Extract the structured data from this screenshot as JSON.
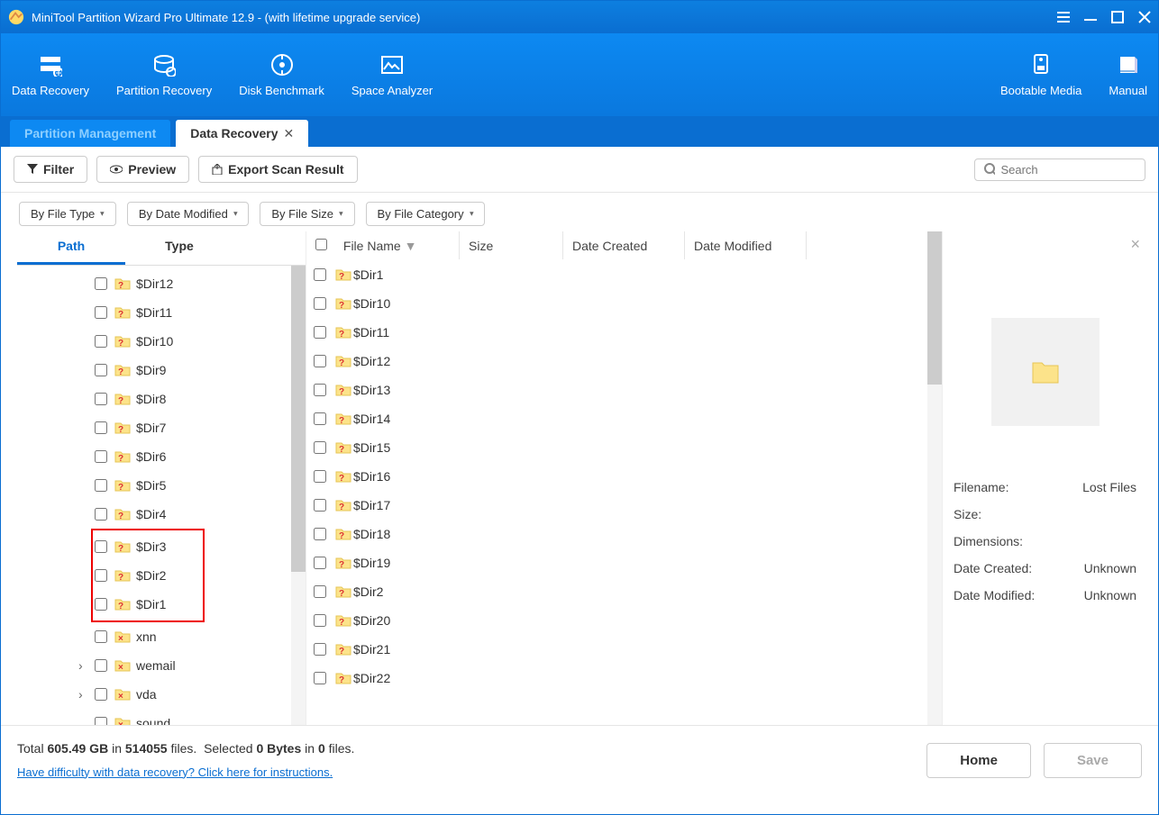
{
  "window": {
    "title": "MiniTool Partition Wizard Pro Ultimate 12.9 - (with lifetime upgrade service)"
  },
  "toolbar_left": [
    {
      "label": "Data Recovery"
    },
    {
      "label": "Partition Recovery"
    },
    {
      "label": "Disk Benchmark"
    },
    {
      "label": "Space Analyzer"
    }
  ],
  "toolbar_right": [
    {
      "label": "Bootable Media"
    },
    {
      "label": "Manual"
    }
  ],
  "tabs": {
    "inactive": "Partition Management",
    "active": "Data Recovery"
  },
  "actions": {
    "filter": "Filter",
    "preview": "Preview",
    "export": "Export Scan Result",
    "search_ph": "Search"
  },
  "filters": [
    "By File Type",
    "By Date Modified",
    "By File Size",
    "By File Category"
  ],
  "treetabs": {
    "path": "Path",
    "type": "Type"
  },
  "tree": [
    {
      "name": "$Dir12",
      "icon": "q"
    },
    {
      "name": "$Dir11",
      "icon": "q"
    },
    {
      "name": "$Dir10",
      "icon": "q"
    },
    {
      "name": "$Dir9",
      "icon": "q"
    },
    {
      "name": "$Dir8",
      "icon": "q"
    },
    {
      "name": "$Dir7",
      "icon": "q"
    },
    {
      "name": "$Dir6",
      "icon": "q"
    },
    {
      "name": "$Dir5",
      "icon": "q"
    },
    {
      "name": "$Dir4",
      "icon": "q"
    },
    {
      "name": "$Dir3",
      "icon": "q",
      "hl": true
    },
    {
      "name": "$Dir2",
      "icon": "q",
      "hl": true
    },
    {
      "name": "$Dir1",
      "icon": "q",
      "hl": true
    },
    {
      "name": "xnn",
      "icon": "x"
    },
    {
      "name": "wemail",
      "icon": "x",
      "expand": true
    },
    {
      "name": "vda",
      "icon": "x",
      "expand": true
    },
    {
      "name": "sound",
      "icon": "x"
    }
  ],
  "cols": {
    "name": "File Name",
    "size": "Size",
    "dc": "Date Created",
    "dm": "Date Modified"
  },
  "files": [
    "$Dir1",
    "$Dir10",
    "$Dir11",
    "$Dir12",
    "$Dir13",
    "$Dir14",
    "$Dir15",
    "$Dir16",
    "$Dir17",
    "$Dir18",
    "$Dir19",
    "$Dir2",
    "$Dir20",
    "$Dir21",
    "$Dir22"
  ],
  "meta": {
    "filename_k": "Filename:",
    "filename_v": "Lost Files",
    "size_k": "Size:",
    "size_v": "",
    "dim_k": "Dimensions:",
    "dim_v": "",
    "dc_k": "Date Created:",
    "dc_v": "Unknown",
    "dm_k": "Date Modified:",
    "dm_v": "Unknown"
  },
  "stats": {
    "total": "605.49 GB",
    "in": "514055",
    "filesword": "files.",
    "selword": "Selected",
    "selbytes": "0 Bytes",
    "inword": "in",
    "selfiles": "0",
    "help": "Have difficulty with data recovery? Click here for instructions."
  },
  "buttons": {
    "home": "Home",
    "save": "Save"
  }
}
